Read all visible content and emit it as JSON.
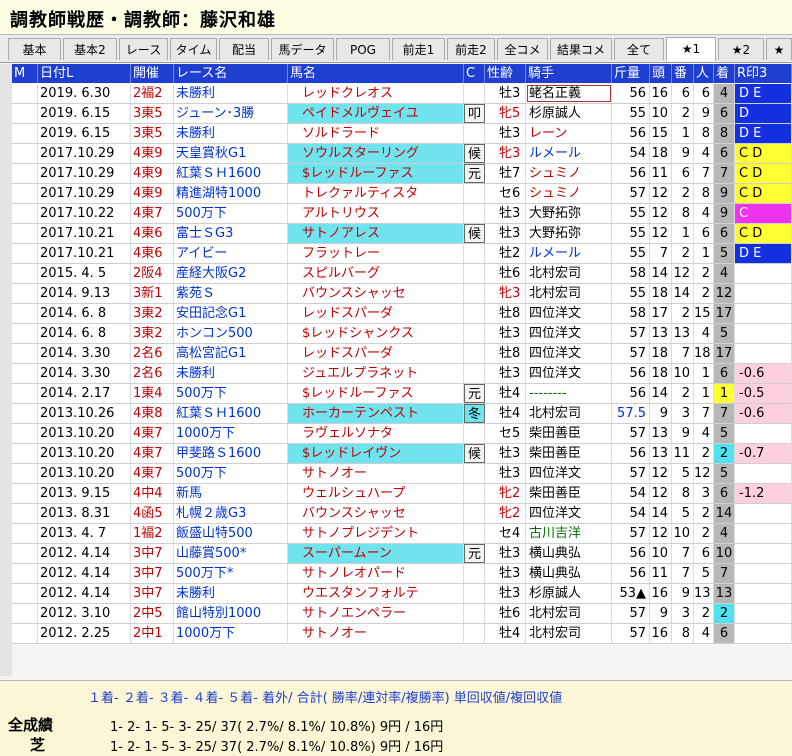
{
  "window": {
    "title": "調教師戦歴・調教師：藤沢和雄"
  },
  "tabs": [
    "基本",
    "基本2",
    "レース",
    "タイム",
    "配当",
    "馬データ",
    "POG",
    "前走1",
    "前走2",
    "全コメ",
    "結果コメ",
    "全て",
    "★1",
    "★2",
    "★"
  ],
  "active_tab": "★1",
  "columns": [
    "M",
    "日付L",
    "開催",
    "レース名",
    "馬名",
    "C",
    "性齢",
    "騎手",
    "斤量",
    "頭",
    "番",
    "人",
    "着",
    "R印3"
  ],
  "rows": [
    {
      "date": "2019. 6.30",
      "kaisai": "2福2",
      "race": "未勝利",
      "horse": "レッドクレオス",
      "c": "",
      "sex": "牡3",
      "jockey": "蛯名正義",
      "kin": "56",
      "to": "16",
      "ban": "6",
      "nin": "6",
      "chaku": "4",
      "r3": "D E"
    },
    {
      "date": "2019. 6.15",
      "kaisai": "3東5",
      "race": "ジューン･3勝",
      "horse": "ペイドメルヴェイユ",
      "c": "叩",
      "sex": "牝5",
      "jockey": "杉原誠人",
      "kin": "55",
      "to": "10",
      "ban": "2",
      "nin": "9",
      "chaku": "6",
      "r3": "D"
    },
    {
      "date": "2019. 6.15",
      "kaisai": "3東5",
      "race": "未勝利",
      "horse": "ソルドラード",
      "c": "",
      "sex": "牡3",
      "jockey": "レーン",
      "kin": "56",
      "to": "15",
      "ban": "1",
      "nin": "8",
      "chaku": "8",
      "r3": "D E"
    },
    {
      "date": "2017.10.29",
      "kaisai": "4東9",
      "race": "天皇賞秋G1",
      "horse": "ソウルスターリング",
      "c": "候",
      "sex": "牝3",
      "jockey": "ルメール",
      "kin": "54",
      "to": "18",
      "ban": "9",
      "nin": "4",
      "chaku": "6",
      "r3": "C D"
    },
    {
      "date": "2017.10.29",
      "kaisai": "4東9",
      "race": "紅葉ＳＨ1600",
      "horse": "$レッドルーファス",
      "c": "元",
      "sex": "牡7",
      "jockey": "シュミノ",
      "kin": "56",
      "to": "11",
      "ban": "6",
      "nin": "7",
      "chaku": "7",
      "r3": "C D"
    },
    {
      "date": "2017.10.29",
      "kaisai": "4東9",
      "race": "精進湖特1000",
      "horse": "トレクァルティスタ",
      "c": "",
      "sex": "セ6",
      "jockey": "シュミノ",
      "kin": "57",
      "to": "12",
      "ban": "2",
      "nin": "8",
      "chaku": "9",
      "r3": "C D"
    },
    {
      "date": "2017.10.22",
      "kaisai": "4東7",
      "race": "500万下",
      "horse": "アルトリウス",
      "c": "",
      "sex": "牡3",
      "jockey": "大野拓弥",
      "kin": "55",
      "to": "12",
      "ban": "8",
      "nin": "4",
      "chaku": "9",
      "r3": "C"
    },
    {
      "date": "2017.10.21",
      "kaisai": "4東6",
      "race": "富士ＳG3",
      "horse": "サトノアレス",
      "c": "候",
      "sex": "牡3",
      "jockey": "大野拓弥",
      "kin": "55",
      "to": "12",
      "ban": "1",
      "nin": "6",
      "chaku": "6",
      "r3": "C D"
    },
    {
      "date": "2017.10.21",
      "kaisai": "4東6",
      "race": "アイビー",
      "horse": "フラットレー",
      "c": "",
      "sex": "牡2",
      "jockey": "ルメール",
      "kin": "55",
      "to": "7",
      "ban": "2",
      "nin": "1",
      "chaku": "5",
      "r3": "D E"
    },
    {
      "date": "2015. 4. 5",
      "kaisai": "2阪4",
      "race": "産経大阪G2",
      "horse": "スピルバーグ",
      "c": "",
      "sex": "牡6",
      "jockey": "北村宏司",
      "kin": "58",
      "to": "14",
      "ban": "12",
      "nin": "2",
      "chaku": "4",
      "r3": ""
    },
    {
      "date": "2014. 9.13",
      "kaisai": "3新1",
      "race": "紫苑Ｓ",
      "horse": "バウンスシャッセ",
      "c": "",
      "sex": "牝3",
      "jockey": "北村宏司",
      "kin": "55",
      "to": "18",
      "ban": "14",
      "nin": "2",
      "chaku": "12",
      "r3": ""
    },
    {
      "date": "2014. 6. 8",
      "kaisai": "3東2",
      "race": "安田記念G1",
      "horse": "レッドスパーダ",
      "c": "",
      "sex": "牡8",
      "jockey": "四位洋文",
      "kin": "58",
      "to": "17",
      "ban": "2",
      "nin": "15",
      "chaku": "17",
      "r3": ""
    },
    {
      "date": "2014. 6. 8",
      "kaisai": "3東2",
      "race": "ホンコン500",
      "horse": "$レッドシャンクス",
      "c": "",
      "sex": "牡3",
      "jockey": "四位洋文",
      "kin": "57",
      "to": "13",
      "ban": "13",
      "nin": "4",
      "chaku": "5",
      "r3": ""
    },
    {
      "date": "2014. 3.30",
      "kaisai": "2名6",
      "race": "高松宮記G1",
      "horse": "レッドスパーダ",
      "c": "",
      "sex": "牡8",
      "jockey": "四位洋文",
      "kin": "57",
      "to": "18",
      "ban": "7",
      "nin": "18",
      "chaku": "17",
      "r3": ""
    },
    {
      "date": "2014. 3.30",
      "kaisai": "2名6",
      "race": "未勝利",
      "horse": "ジュエルプラネット",
      "c": "",
      "sex": "牡3",
      "jockey": "四位洋文",
      "kin": "56",
      "to": "18",
      "ban": "10",
      "nin": "1",
      "chaku": "6",
      "r3": "-0.6"
    },
    {
      "date": "2014. 2.17",
      "kaisai": "1東4",
      "race": "500万下",
      "horse": "$レッドルーファス",
      "c": "元",
      "sex": "牡4",
      "jockey": "--------",
      "kin": "56",
      "to": "14",
      "ban": "2",
      "nin": "1",
      "chaku": "1",
      "r3": "-0.5"
    },
    {
      "date": "2013.10.26",
      "kaisai": "4東8",
      "race": "紅葉ＳＨ1600",
      "horse": "ホーカーテンペスト",
      "c": "冬",
      "sex": "牡4",
      "jockey": "北村宏司",
      "kin": "57.5",
      "to": "9",
      "ban": "3",
      "nin": "7",
      "chaku": "7",
      "r3": "-0.6"
    },
    {
      "date": "2013.10.20",
      "kaisai": "4東7",
      "race": "1000万下",
      "horse": "ラヴェルソナタ",
      "c": "",
      "sex": "セ5",
      "jockey": "柴田善臣",
      "kin": "57",
      "to": "13",
      "ban": "9",
      "nin": "4",
      "chaku": "5",
      "r3": ""
    },
    {
      "date": "2013.10.20",
      "kaisai": "4東7",
      "race": "甲斐路Ｓ1600",
      "horse": "$レッドレイヴン",
      "c": "候",
      "sex": "牡3",
      "jockey": "柴田善臣",
      "kin": "56",
      "to": "13",
      "ban": "11",
      "nin": "2",
      "chaku": "2",
      "r3": "-0.7"
    },
    {
      "date": "2013.10.20",
      "kaisai": "4東7",
      "race": "500万下",
      "horse": "サトノオー",
      "c": "",
      "sex": "牡3",
      "jockey": "四位洋文",
      "kin": "57",
      "to": "12",
      "ban": "5",
      "nin": "12",
      "chaku": "5",
      "r3": ""
    },
    {
      "date": "2013. 9.15",
      "kaisai": "4中4",
      "race": "新馬",
      "horse": "ウェルシュハープ",
      "c": "",
      "sex": "牝2",
      "jockey": "柴田善臣",
      "kin": "54",
      "to": "12",
      "ban": "8",
      "nin": "3",
      "chaku": "6",
      "r3": "-1.2"
    },
    {
      "date": "2013. 8.31",
      "kaisai": "4函5",
      "race": "札幌２歳G3",
      "horse": "バウンスシャッセ",
      "c": "",
      "sex": "牝2",
      "jockey": "四位洋文",
      "kin": "54",
      "to": "14",
      "ban": "5",
      "nin": "2",
      "chaku": "14",
      "r3": ""
    },
    {
      "date": "2013. 4. 7",
      "kaisai": "1福2",
      "race": "飯盛山特500",
      "horse": "サトノプレジデント",
      "c": "",
      "sex": "セ4",
      "jockey": "古川吉洋",
      "kin": "57",
      "to": "12",
      "ban": "10",
      "nin": "2",
      "chaku": "4",
      "r3": ""
    },
    {
      "date": "2012. 4.14",
      "kaisai": "3中7",
      "race": "山藤賞500*",
      "horse": "スーパームーン",
      "c": "元",
      "sex": "牡3",
      "jockey": "横山典弘",
      "kin": "56",
      "to": "10",
      "ban": "7",
      "nin": "6",
      "chaku": "10",
      "r3": ""
    },
    {
      "date": "2012. 4.14",
      "kaisai": "3中7",
      "race": "500万下*",
      "horse": "サトノレオパード",
      "c": "",
      "sex": "牡3",
      "jockey": "横山典弘",
      "kin": "56",
      "to": "11",
      "ban": "7",
      "nin": "5",
      "chaku": "7",
      "r3": ""
    },
    {
      "date": "2012. 4.14",
      "kaisai": "3中7",
      "race": "未勝利",
      "horse": "ウエスタンフォルテ",
      "c": "",
      "sex": "牡3",
      "jockey": "杉原誠人",
      "kin": "53▲",
      "to": "16",
      "ban": "9",
      "nin": "13",
      "chaku": "13",
      "r3": ""
    },
    {
      "date": "2012. 3.10",
      "kaisai": "2中5",
      "race": "館山特別1000",
      "horse": "サトノエンペラー",
      "c": "",
      "sex": "牡6",
      "jockey": "北村宏司",
      "kin": "57",
      "to": "9",
      "ban": "3",
      "nin": "2",
      "chaku": "2",
      "r3": ""
    },
    {
      "date": "2012. 2.25",
      "kaisai": "2中1",
      "race": "1000万下",
      "horse": "サトノオー",
      "c": "",
      "sex": "牡4",
      "jockey": "北村宏司",
      "kin": "57",
      "to": "16",
      "ban": "8",
      "nin": "4",
      "chaku": "6",
      "r3": ""
    }
  ],
  "footer": {
    "header": "１着- ２着- ３着- ４着- ５着- 着外/ 合計( 勝率/連対率/複勝率) 単回収値/複回収値",
    "rows": [
      {
        "label": "全成績",
        "values": "1-     2-     1-     5-     3-    25/    37(  2.7%/  8.1%/ 10.8%)       9円  /     16円"
      },
      {
        "label": "芝",
        "values": "1-     2-     1-     5-     3-    25/    37(  2.7%/  8.1%/ 10.8%)       9円  /     16円"
      }
    ]
  }
}
